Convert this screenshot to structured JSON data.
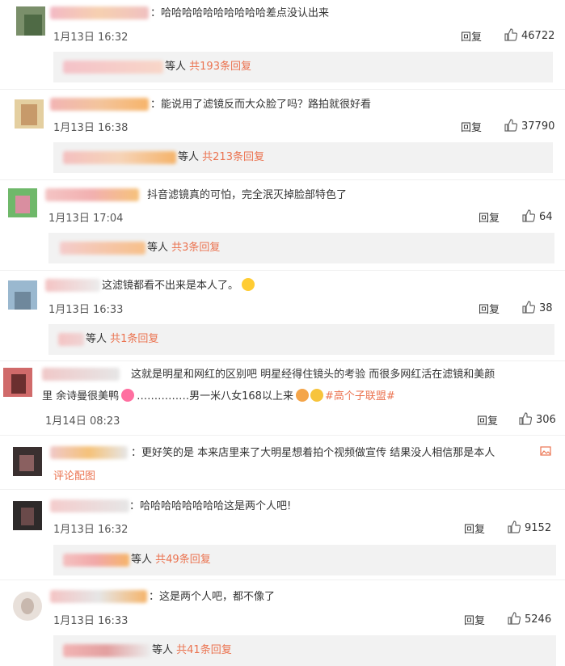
{
  "ui": {
    "reply_label": "回复",
    "people_suffix": "等人",
    "accent": "#eb7350"
  },
  "comments": [
    {
      "text": "：哈哈哈哈哈哈哈哈哈哈差点没认出来",
      "time": "1月13日 16:32",
      "likes": "46722",
      "box_count": "共193条回复"
    },
    {
      "text": "：能说用了滤镜反而大众脸了吗？路拍就很好看",
      "time": "1月13日 16:38",
      "likes": "37790",
      "box_count": "共213条回复"
    },
    {
      "text": "抖音滤镜真的可怕，完全泯灭掉脸部特色了",
      "time": "1月13日 17:04",
      "likes": "64",
      "box_count": "共3条回复"
    },
    {
      "text": "这滤镜都看不出来是本人了。",
      "time": "1月13日 16:33",
      "likes": "38",
      "box_count": "共1条回复"
    },
    {
      "text_line1": "这就是明星和网红的区别吧  明星经得住镜头的考验  而很多网红活在滤镜和美颜",
      "text_line2_a": "里  余诗曼很美鸭",
      "text_line2_b": "……………男一米八女168以上来",
      "hashtag": "#高个子联盟#",
      "time": "1月14日 08:23",
      "likes": "306"
    },
    {
      "text": "：更好笑的是 本来店里来了大明星想着拍个视频做宣传 结果没人相信那是本人",
      "pic_label": "评论配图"
    },
    {
      "text": "：哈哈哈哈哈哈哈哈这是两个人吧!",
      "time": "1月13日 16:32",
      "likes": "9152",
      "box_count": "共49条回复"
    },
    {
      "text": "：这是两个人吧，都不像了",
      "time": "1月13日 16:33",
      "likes": "5246",
      "box_count": "共41条回复"
    }
  ]
}
